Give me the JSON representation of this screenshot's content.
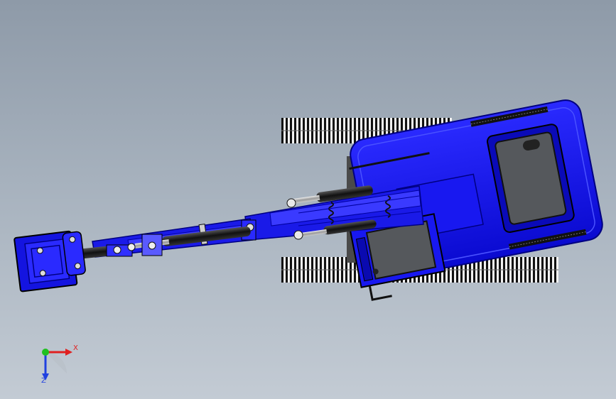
{
  "triad": {
    "x_label": "X",
    "z_label": "Z",
    "colors": {
      "x": "#e02020",
      "y": "#20c020",
      "z": "#2040e0"
    }
  },
  "model": {
    "colors": {
      "body": "#1010e8",
      "body_dark": "#0000a0",
      "body_light": "#4a52ff",
      "track": "#111111",
      "cab_glass": "#55585c",
      "cylinder": "#222222"
    }
  }
}
